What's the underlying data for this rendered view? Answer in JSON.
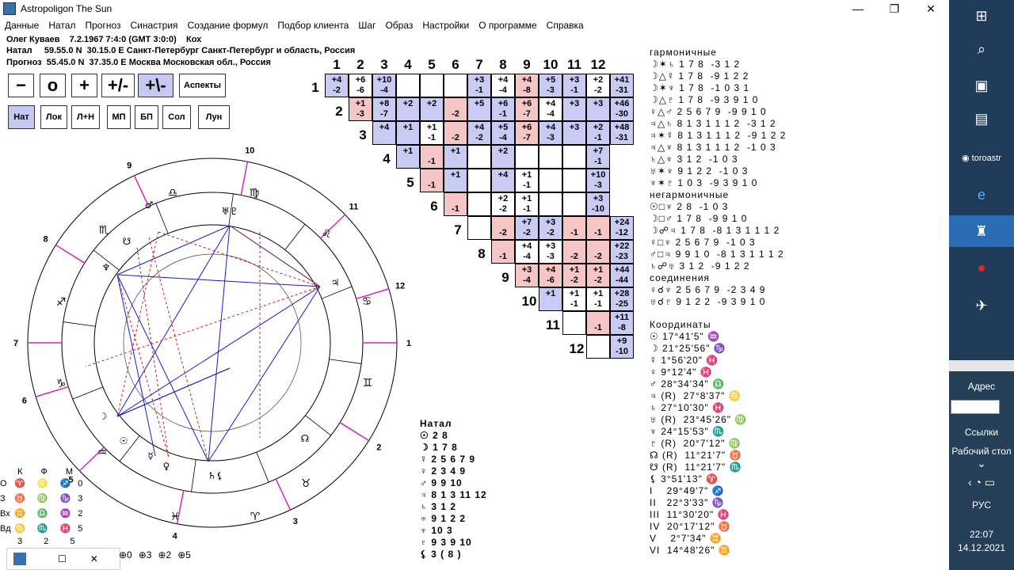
{
  "window": {
    "title": "Astropoligon The Sun",
    "minimize": "—",
    "restore": "❐",
    "close": "✕"
  },
  "menu": [
    "Данные",
    "Натал",
    "Прогноз",
    "Синастрия",
    "Создание формул",
    "Подбор клиента",
    "Шаг",
    "Образ",
    "Настройки",
    "О программе",
    "Справка"
  ],
  "info": {
    "line1": "Олег Куваев    7.2.1967 7:4:0 (GMT 3:0:0)    Кох",
    "line2": "Натал     59.55.0 N  30.15.0 E Санкт-Петербург Санкт-Петербург и область, Россия",
    "line3": "Прогноз  55.45.0 N  37.35.0 E Москва Московская обл., Россия"
  },
  "toolbar1": [
    "−",
    "o",
    "+",
    "+/-",
    "+\\-",
    "Аспекты"
  ],
  "toolbar2": [
    "Нат",
    "Лок",
    "Л+Н",
    "МП",
    "БП",
    "Сол",
    "Лун"
  ],
  "grid": {
    "cols": [
      "1",
      "2",
      "3",
      "4",
      "5",
      "6",
      "7",
      "8",
      "9",
      "10",
      "11",
      "12"
    ],
    "rows": [
      "1",
      "2",
      "3",
      "4",
      "5",
      "6",
      "7",
      "8",
      "9",
      "10",
      "11",
      "12"
    ],
    "cells": [
      [
        [
          "+4\n-2",
          "b"
        ],
        [
          "+6\n-6",
          ""
        ],
        [
          "+10\n-4",
          "b"
        ],
        [
          "",
          ""
        ],
        [
          "",
          ""
        ],
        [
          "",
          ""
        ],
        [
          "+3\n-1",
          "b"
        ],
        [
          "+4\n-4",
          ""
        ],
        [
          "+4\n-8",
          "r"
        ],
        [
          "+5\n-3",
          "b"
        ],
        [
          "+3\n-1",
          "b"
        ],
        [
          "+2\n-2",
          ""
        ],
        [
          "+41\n-31",
          "b"
        ]
      ],
      [
        [
          "+1\n-3",
          "r"
        ],
        [
          "+8\n-7",
          "b"
        ],
        [
          "+2",
          "b"
        ],
        [
          "+2",
          "b"
        ],
        [
          "\n-2",
          "r"
        ],
        [
          "+5",
          "b"
        ],
        [
          "+6\n-1",
          "b"
        ],
        [
          "+6\n-7",
          "r"
        ],
        [
          "+4\n-4",
          ""
        ],
        [
          "+3",
          "b"
        ],
        [
          "+3",
          "b"
        ],
        [
          "+46\n-30",
          "b"
        ]
      ],
      [
        [
          "+4",
          "b"
        ],
        [
          "+1",
          "b"
        ],
        [
          "+1\n-1",
          ""
        ],
        [
          "\n-2",
          "r"
        ],
        [
          "+4\n-2",
          "b"
        ],
        [
          "+5\n-4",
          "b"
        ],
        [
          "+6\n-7",
          "r"
        ],
        [
          "+4\n-3",
          "b"
        ],
        [
          "+3",
          "b"
        ],
        [
          "+2\n-1",
          "b"
        ],
        [
          "+48\n-31",
          "b"
        ]
      ],
      [
        [
          "+1",
          "b"
        ],
        [
          "\n-1",
          "r"
        ],
        [
          "+1",
          "b"
        ],
        [
          "",
          ""
        ],
        [
          "+2",
          "b"
        ],
        [
          "",
          ""
        ],
        [
          "",
          ""
        ],
        [
          "",
          ""
        ],
        [
          "+7\n-1",
          "b"
        ]
      ],
      [
        [
          "\n-1",
          "r"
        ],
        [
          "+1",
          "b"
        ],
        [
          "",
          ""
        ],
        [
          "+4",
          "b"
        ],
        [
          "+1\n-1",
          ""
        ],
        [
          "",
          ""
        ],
        [
          "",
          ""
        ],
        [
          "+10\n-3",
          "b"
        ]
      ],
      [
        [
          "\n-1",
          "r"
        ],
        [
          "",
          ""
        ],
        [
          "+2\n-2",
          ""
        ],
        [
          "+1\n-1",
          ""
        ],
        [
          "",
          ""
        ],
        [
          "",
          ""
        ],
        [
          "+3\n-10",
          "b"
        ]
      ],
      [
        [
          "",
          ""
        ],
        [
          "\n-2",
          "r"
        ],
        [
          "+7\n-2",
          "b"
        ],
        [
          "+3\n-2",
          "b"
        ],
        [
          "\n-1",
          "r"
        ],
        [
          "\n-1",
          "r"
        ],
        [
          "+24\n-12",
          "b"
        ]
      ],
      [
        [
          "\n-1",
          "r"
        ],
        [
          "+4\n-4",
          ""
        ],
        [
          "+3\n-3",
          ""
        ],
        [
          "\n-2",
          "r"
        ],
        [
          "\n-2",
          "r"
        ],
        [
          "+22\n-23",
          "b"
        ]
      ],
      [
        [
          "+3\n-4",
          "r"
        ],
        [
          "+4\n-6",
          "r"
        ],
        [
          "+1\n-2",
          "r"
        ],
        [
          "+1\n-2",
          "r"
        ],
        [
          "+44\n-44",
          "b"
        ]
      ],
      [
        [
          "+1",
          "b"
        ],
        [
          "+1\n-1",
          ""
        ],
        [
          "+1\n-1",
          ""
        ],
        [
          "+28\n-25",
          "b"
        ]
      ],
      [
        [
          "",
          ""
        ],
        [
          "\n-1",
          "r"
        ],
        [
          "+11\n-8",
          "b"
        ]
      ],
      [
        [
          "",
          ""
        ],
        [
          "+9\n-10",
          "b"
        ]
      ]
    ]
  },
  "aspects": {
    "harm_title": "гармоничные",
    "harm": [
      "☽✶♄ 1 7 8  -3 1 2",
      "☽△☿ 1 7 8  -9 1 2 2",
      "☽✶♆ 1 7 8  -1 0 3 1",
      "☽△♇ 1 7 8  -9 3 9 1 0",
      "♀△♂ 2 5 6 7 9  -9 9 1 0",
      "♃△♄ 8 1 3 1 1 1 2  -3 1 2",
      "♃✶☿ 8 1 3 1 1 1 2  -9 1 2 2",
      "♃△♆ 8 1 3 1 1 1 2  -1 0 3",
      "♄△♆ 3 1 2  -1 0 3",
      "♅✶♆ 9 1 2 2  -1 0 3",
      "♆✶♇ 1 0 3  -9 3 9 1 0"
    ],
    "nonharm_title": "негармоничные",
    "nonharm": [
      "☉□♆ 2 8  -1 0 3",
      "☽□♂ 1 7 8  -9 9 1 0",
      "☽☍♃ 1 7 8  -8 1 3 1 1 1 2",
      "♀□♆ 2 5 6 7 9  -1 0 3",
      "♂□♃ 9 9 1 0  -8 1 3 1 1 1 2",
      "♄☍♅ 3 1 2  -9 1 2 2"
    ],
    "conj_title": "соединения",
    "conj": [
      "♀☌♆ 2 5 6 7 9  -2 3 4 9",
      "♅☌♇ 9 1 2 2  -9 3 9 1 0"
    ],
    "coord_title": "Координаты",
    "coords": [
      "☉ 17°41'5\" ♒",
      "☽ 21°25'56\" ♑",
      "☿ 1°56'20\" ♓",
      "♀ 9°12'4\" ♓",
      "♂ 28°34'34\" ♎",
      "♃ (R)  27°8'37\" ♋",
      "♄ 27°10'30\" ♓",
      "♅ (R)  23°45'26\" ♍",
      "♆ 24°15'53\" ♏",
      "♇ (R)  20°7'12\" ♍",
      "☊ (R)  11°21'7\" ♉",
      "☋ (R)  11°21'7\" ♏",
      "⚸ 3°51'13\" ♈",
      "I    29°49'7\" ♐",
      "II   22°3'33\" ♑",
      "III  11°30'20\" ♓",
      "IV  20°17'12\" ♉",
      "V    2°7'34\" ♊",
      "VI  14°48'26\" ♊"
    ]
  },
  "natal": {
    "title": "Натал",
    "lines": [
      "☉ 2 8",
      "☽ 1 7 8",
      "☿ 2 5 6 7 9",
      "♀ 2 3 4 9",
      "♂ 9 9 10",
      "♃ 8 1 3 11 12",
      "♄ 3 1 2",
      "♅ 9 1 2 2",
      "♆ 10 3",
      "♇ 9 3 9 10",
      "⚸ 3 ( 8 )"
    ]
  },
  "legend": {
    "header": [
      "К",
      "Ф",
      "М"
    ],
    "rows": [
      [
        "О",
        "♈ ♌ ♐",
        "0"
      ],
      [
        "З",
        "♉ ♍ ♑",
        "3"
      ],
      [
        "Вх",
        "♊ ♎ ♒",
        "2"
      ],
      [
        "Вд",
        "♋ ♏ ♓",
        "5"
      ]
    ],
    "footer": [
      "3",
      "2",
      "5"
    ],
    "modes": [
      "0",
      "3",
      "2",
      "5"
    ]
  },
  "houses": [
    "1",
    "2",
    "3",
    "4",
    "5",
    "6",
    "7",
    "8",
    "9",
    "10",
    "11",
    "12"
  ],
  "side": {
    "addr": "Адрес",
    "links": "Ссылки",
    "desktop": "Рабочий стол",
    "lang": "РУС",
    "time": "22:07",
    "date": "14.12.2021",
    "toroastr": "toroastr"
  }
}
